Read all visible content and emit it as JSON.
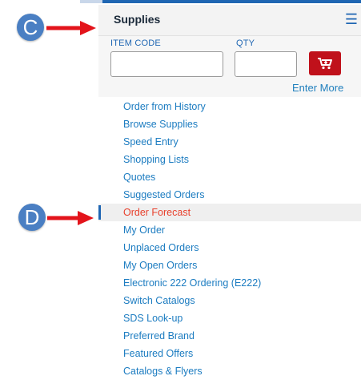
{
  "sidebar": {
    "title": "Supplies",
    "menu_icon": "hamburger-icon",
    "item_code_label": "ITEM CODE",
    "qty_label": "QTY",
    "item_code_value": "",
    "qty_value": "",
    "cart_icon": "cart-icon",
    "enter_more": "Enter More",
    "items": [
      {
        "label": "Order from History"
      },
      {
        "label": "Browse Supplies"
      },
      {
        "label": "Speed Entry"
      },
      {
        "label": "Shopping Lists"
      },
      {
        "label": "Quotes"
      },
      {
        "label": "Suggested Orders"
      },
      {
        "label": "Order Forecast"
      },
      {
        "label": "My Order"
      },
      {
        "label": "Unplaced Orders"
      },
      {
        "label": "My Open Orders"
      },
      {
        "label": "Electronic 222 Ordering (E222)"
      },
      {
        "label": "Switch Catalogs"
      },
      {
        "label": "SDS Look-up"
      },
      {
        "label": "Preferred Brand"
      },
      {
        "label": "Featured Offers"
      },
      {
        "label": "Catalogs & Flyers"
      }
    ],
    "active_index": 6
  },
  "annotations": {
    "c_label": "C",
    "d_label": "D",
    "callout_color": "#4a7fc3",
    "arrow_color": "#e3141b"
  },
  "colors": {
    "link": "#1c7cc1",
    "active": "#e8412d",
    "brand": "#1f66b3",
    "cart_button": "#c0111b"
  }
}
